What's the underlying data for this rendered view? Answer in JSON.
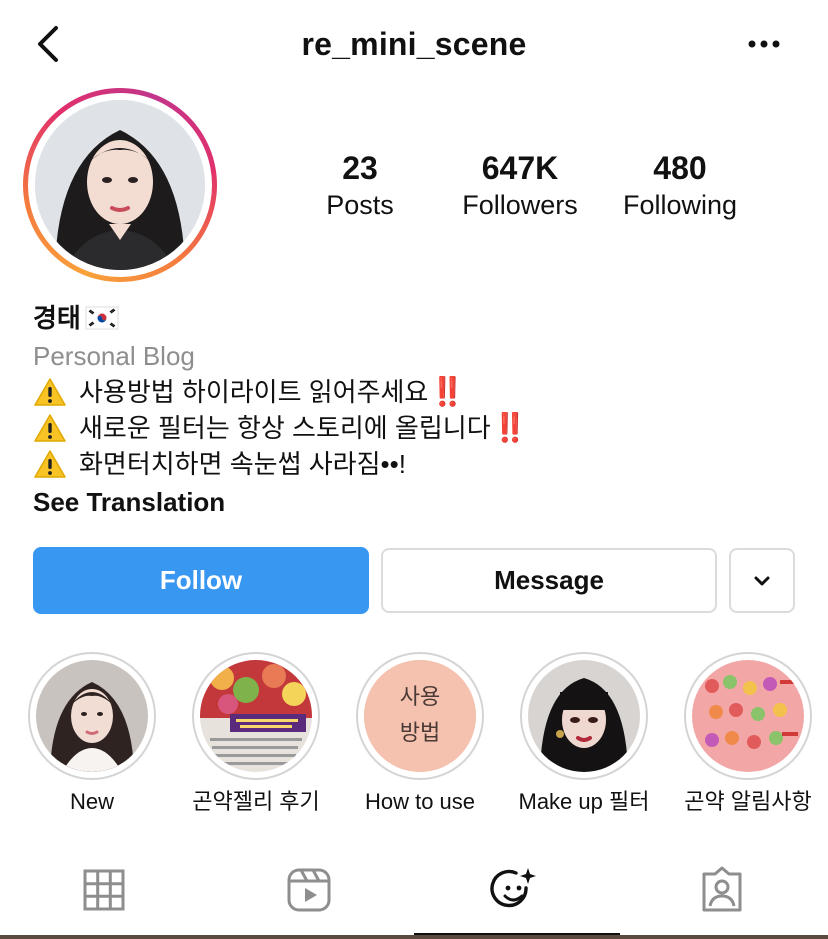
{
  "header": {
    "username": "re_mini_scene",
    "back_icon": "chevron-left-icon",
    "more_icon": "more-horizontal-icon"
  },
  "stats": [
    {
      "value": "23",
      "label": "Posts"
    },
    {
      "value": "647K",
      "label": "Followers"
    },
    {
      "value": "480",
      "label": "Following"
    }
  ],
  "bio": {
    "name": "경태",
    "name_flag": "korea-flag-icon",
    "category": "Personal Blog",
    "lines": [
      {
        "icon": "warning-icon",
        "text": "사용방법 하이라이트 읽어주세요",
        "suffix": "‼️"
      },
      {
        "icon": "warning-icon",
        "text": "새로운 필터는 항상 스토리에 올립니다",
        "suffix": "‼️"
      },
      {
        "icon": "warning-icon",
        "text": "화면터치하면 속눈썹 사라짐••!",
        "suffix": ""
      }
    ],
    "see_translation": "See Translation"
  },
  "actions": {
    "follow_label": "Follow",
    "message_label": "Message",
    "dropdown_icon": "chevron-down-icon"
  },
  "highlights": [
    {
      "label": "New"
    },
    {
      "label": "곤약젤리 후기"
    },
    {
      "label": "How to use",
      "cover_text_1": "사용",
      "cover_text_2": "방법"
    },
    {
      "label": "Make up 필터"
    },
    {
      "label": "곤약 알림사항"
    }
  ],
  "tabs": [
    {
      "icon": "grid-icon"
    },
    {
      "icon": "reels-icon"
    },
    {
      "icon": "effects-icon",
      "active": true
    },
    {
      "icon": "tagged-icon"
    }
  ],
  "colors": {
    "follow_blue": "#3897f0",
    "secondary_text": "#8e8e8e",
    "border": "#dbdbdb",
    "story_ring_orange": "#f9a23a",
    "story_ring_pink": "#e1306c"
  }
}
